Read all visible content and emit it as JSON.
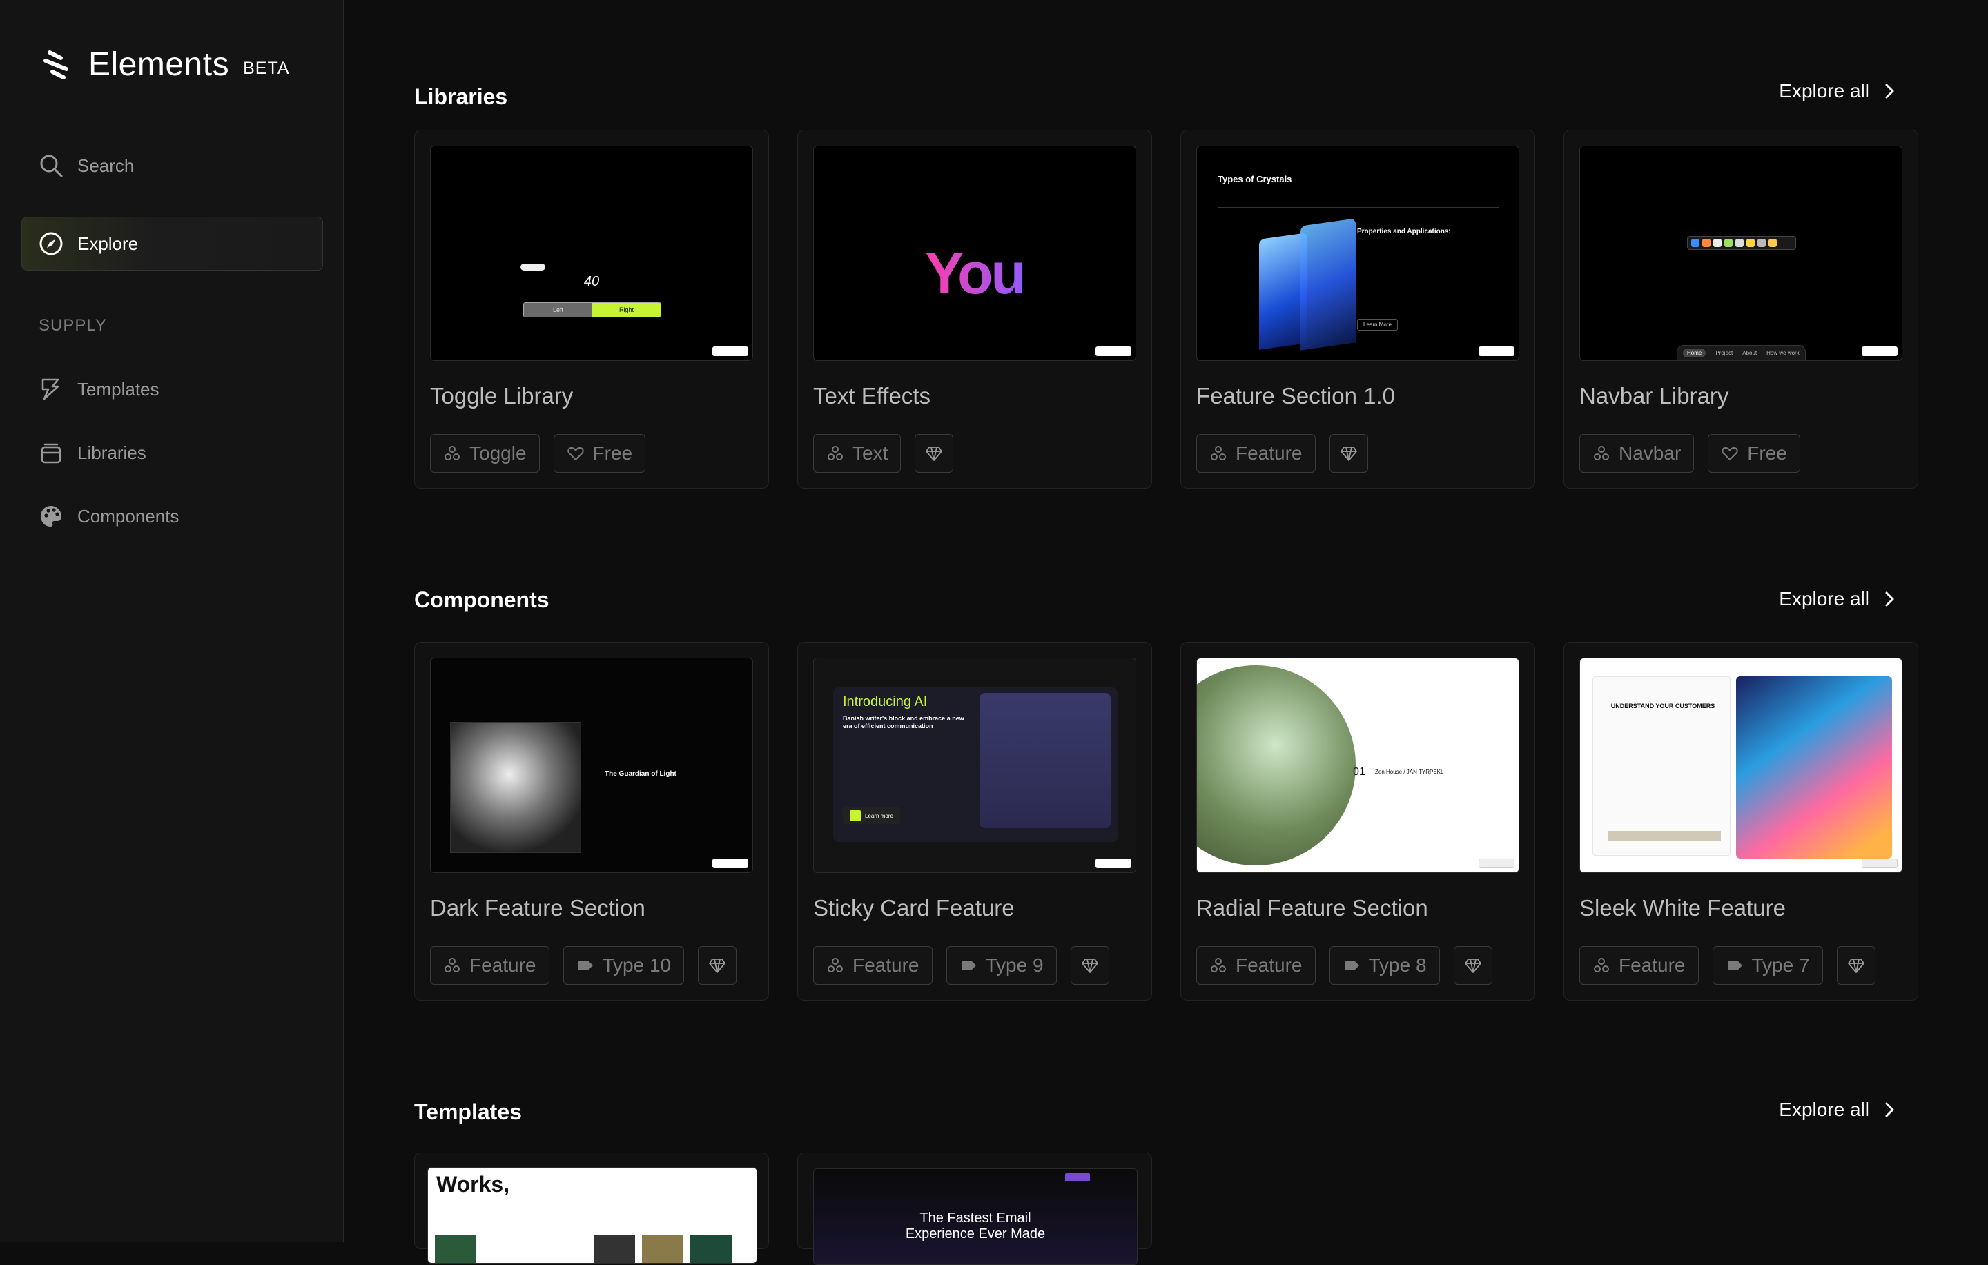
{
  "app": {
    "name": "Elements",
    "badge": "BETA"
  },
  "sidebar": {
    "search_label": "Search",
    "explore_label": "Explore",
    "group_label": "SUPPLY",
    "items": [
      {
        "label": "Templates",
        "icon": "template-icon"
      },
      {
        "label": "Libraries",
        "icon": "library-icon"
      },
      {
        "label": "Components",
        "icon": "palette-icon"
      }
    ]
  },
  "sections": {
    "libraries": {
      "title": "Libraries",
      "explore_all": "Explore all",
      "cards": [
        {
          "title": "Toggle Library",
          "tags": [
            "Toggle",
            "Free"
          ],
          "premium": false
        },
        {
          "title": "Text Effects",
          "tags": [
            "Text"
          ],
          "premium": true
        },
        {
          "title": "Feature Section 1.0",
          "tags": [
            "Feature"
          ],
          "premium": true
        },
        {
          "title": "Navbar Library",
          "tags": [
            "Navbar",
            "Free"
          ],
          "premium": false
        }
      ]
    },
    "components": {
      "title": "Components",
      "explore_all": "Explore all",
      "cards": [
        {
          "title": "Dark Feature Section",
          "tags": [
            "Feature",
            "Type 10"
          ],
          "premium": true
        },
        {
          "title": "Sticky Card Feature",
          "tags": [
            "Feature",
            "Type 9"
          ],
          "premium": true
        },
        {
          "title": "Radial Feature Section",
          "tags": [
            "Feature",
            "Type 8"
          ],
          "premium": true
        },
        {
          "title": "Sleek White Feature",
          "tags": [
            "Feature",
            "Type 7"
          ],
          "premium": true
        }
      ]
    },
    "templates": {
      "title": "Templates",
      "explore_all": "Explore all"
    }
  },
  "thumbnails": {
    "toggle": {
      "counter": "40",
      "left": "Left",
      "right": "Right"
    },
    "text_effects": {
      "word": "You"
    },
    "feature": {
      "heading": "Types of Crystals",
      "sub": "Properties and Applications:",
      "button": "Learn More"
    },
    "navbar": {
      "links": [
        "Home",
        "Project",
        "About",
        "How we work"
      ]
    },
    "dark_feature": {
      "heading": "The Guardian of Light"
    },
    "sticky": {
      "heading": "Introducing AI",
      "sub": "Banish writer's block and embrace a new era of efficient communication",
      "button": "Learn more"
    },
    "radial": {
      "number": "01",
      "heading": "Zen House / JAN TYRPEKL"
    },
    "sleek": {
      "heading": "UNDERSTAND YOUR CUSTOMERS"
    },
    "works": {
      "heading": "Works,"
    },
    "email": {
      "heading": "The Fastest Email Experience Ever Made"
    }
  },
  "colors": {
    "accent": "#c6f432",
    "background": "#0d0d0d",
    "sidebar": "#141414"
  }
}
